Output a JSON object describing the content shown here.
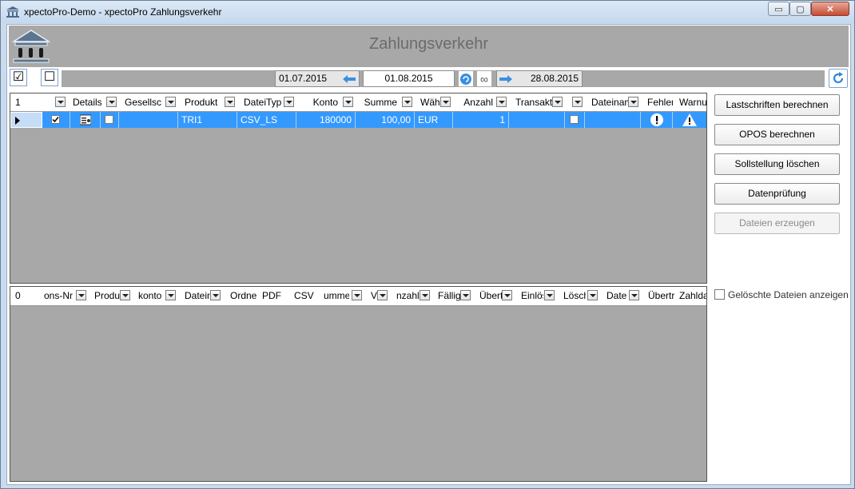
{
  "window": {
    "title": "xpectoPro-Demo - xpectoPro Zahlungsverkehr",
    "controls": {
      "minimize": "▭",
      "maximize": "▢",
      "close": "✕"
    }
  },
  "header": {
    "title": "Zahlungsverkehr",
    "logo_icon": "bank-building-icon"
  },
  "toolbar": {
    "select_all": "☑",
    "deselect_all": "☐",
    "date_from": "01.07.2015",
    "date_current": "01.08.2015",
    "date_to": "28.08.2015",
    "infinity": "∞"
  },
  "upper_grid": {
    "row_count": "1",
    "columns": [
      "Details",
      "Gesellscha",
      "Produkt",
      "DateiTyp",
      "Konto",
      "Summe",
      "Wäh",
      "Anzahl",
      "Transakti",
      "Dateinam",
      "Fehler",
      "Warnu"
    ],
    "rows": [
      {
        "produkt": "TRI1",
        "dateityp": "CSV_LS",
        "konto": "180000",
        "summe": "100,00",
        "waehrung": "EUR",
        "anzahl": "1"
      }
    ]
  },
  "lower_grid": {
    "row_count": "0",
    "columns": [
      "ons-Nr",
      "Produl",
      "konto",
      "Datein",
      "Ordner",
      "PDF",
      "CSV",
      "umme",
      "V",
      "nzahl",
      "Fälligl",
      "Übert",
      "Einlös",
      "Lösch",
      "Datei",
      "Übertra",
      "Zahlda"
    ]
  },
  "side": {
    "buttons": [
      "Lastschriften berechnen",
      "OPOS berechnen",
      "Sollstellung löschen",
      "Datenprüfung",
      "Dateien erzeugen"
    ],
    "show_deleted_label": "Gelöschte Dateien anzeigen"
  },
  "colors": {
    "selection": "#3399ff",
    "header_band": "#a8a8a8",
    "frame": "#c9dbef"
  }
}
